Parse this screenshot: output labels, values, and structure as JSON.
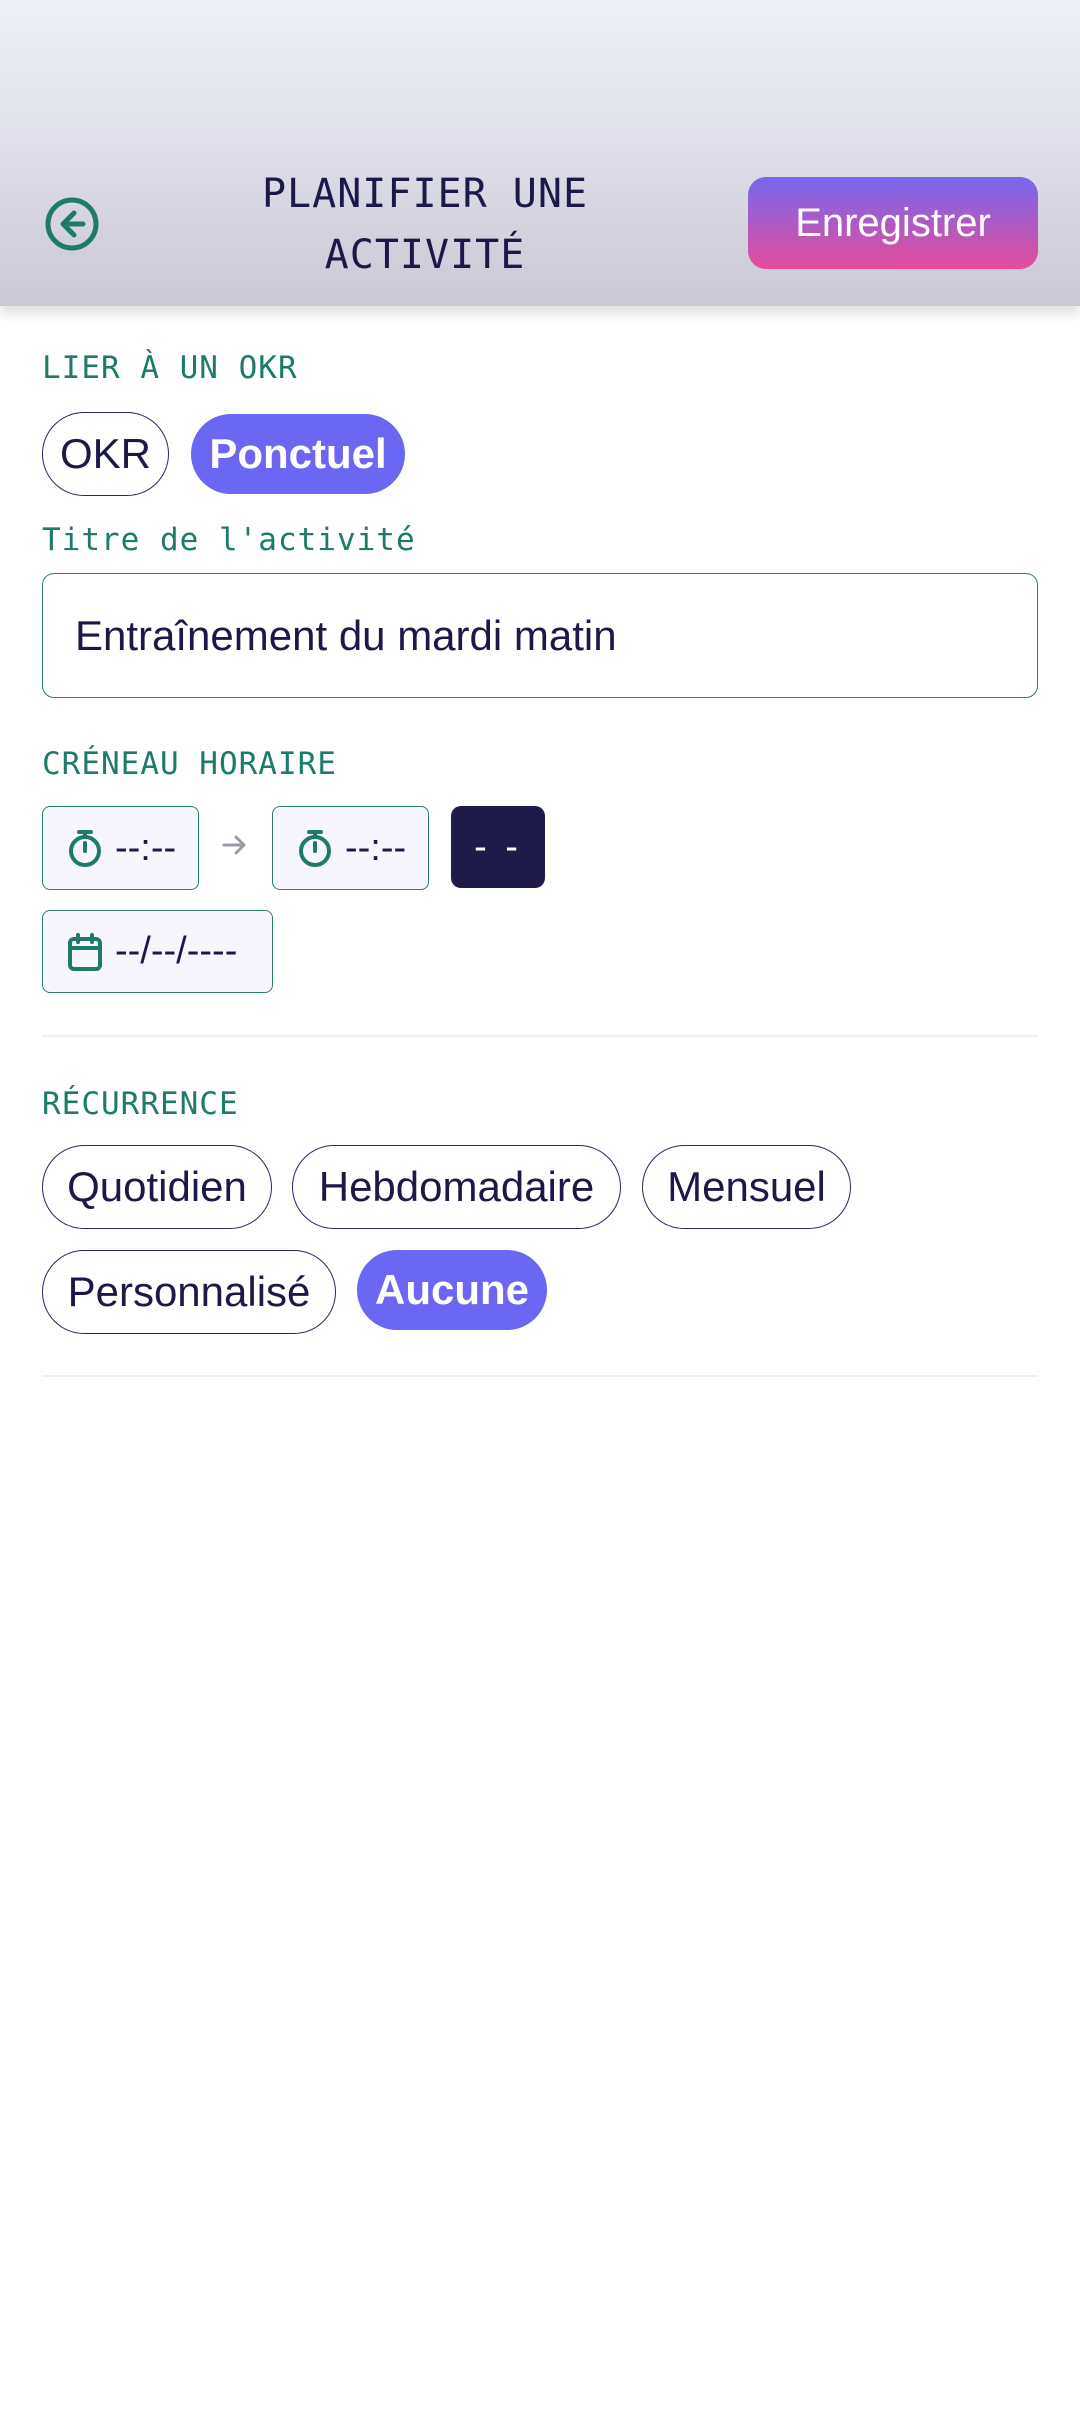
{
  "header": {
    "title_line1": "PLANIFIER UNE",
    "title_line2": "ACTIVITÉ",
    "save_label": "Enregistrer",
    "back_icon": "arrow-left-circle-icon"
  },
  "okr": {
    "label": "LIER À UN OKR",
    "options": [
      {
        "label": "OKR",
        "selected": false
      },
      {
        "label": "Ponctuel",
        "selected": true
      }
    ]
  },
  "activity_title": {
    "label": "Titre de l'activité",
    "value": "Entraînement du mardi matin"
  },
  "time_slot": {
    "label": "CRÉNEAU HORAIRE",
    "start": "--:--",
    "end": "--:--",
    "duration": "- -",
    "date": "--/--/----",
    "timer_icon": "stopwatch-icon",
    "date_icon": "calendar-icon"
  },
  "recurrence": {
    "label": "RÉCURRENCE",
    "options": [
      {
        "label": "Quotidien",
        "selected": false
      },
      {
        "label": "Hebdomadaire",
        "selected": false
      },
      {
        "label": "Mensuel",
        "selected": false
      },
      {
        "label": "Personnalisé",
        "selected": false
      },
      {
        "label": "Aucune",
        "selected": true
      }
    ]
  },
  "colors": {
    "accent": "#6b67f2",
    "teal": "#1e7a6a",
    "navy": "#1c1848",
    "save_gradient_top": "#7467ee",
    "save_gradient_bottom": "#e64d9b"
  }
}
